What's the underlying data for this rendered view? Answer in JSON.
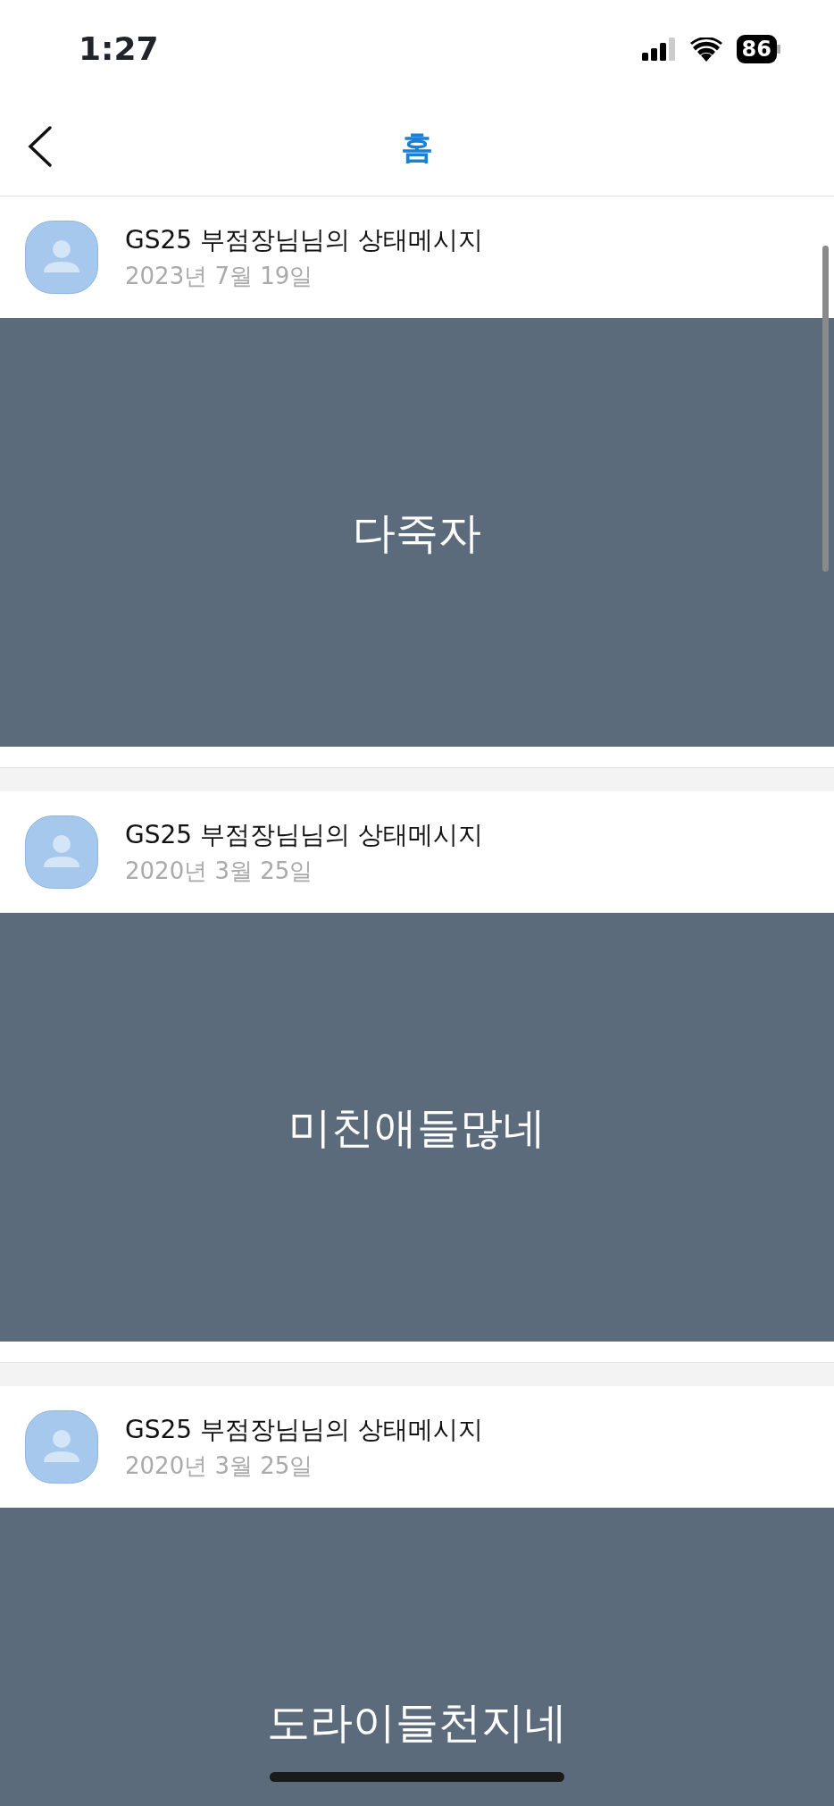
{
  "status_bar": {
    "time": "1:27",
    "battery": "86"
  },
  "nav": {
    "title": "홈"
  },
  "posts": [
    {
      "author": "GS25 부점장님님의 상태메시지",
      "date": "2023년 7월 19일",
      "message": "다죽자"
    },
    {
      "author": "GS25 부점장님님의 상태메시지",
      "date": "2020년 3월 25일",
      "message": "미친애들많네"
    },
    {
      "author": "GS25 부점장님님의 상태메시지",
      "date": "2020년 3월 25일",
      "message": "도라이들천지네"
    }
  ]
}
